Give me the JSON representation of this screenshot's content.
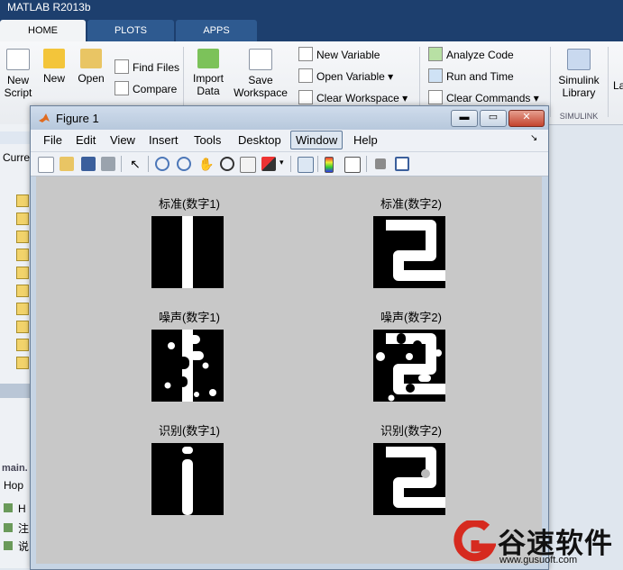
{
  "app_title": "MATLAB R2013b",
  "tabs": [
    "HOME",
    "PLOTS",
    "APPS"
  ],
  "ribbon": {
    "new_script": "New\nScript",
    "new": "New",
    "open": "Open",
    "find_files": "Find Files",
    "compare": "Compare",
    "import_data": "Import\nData",
    "save_workspace": "Save\nWorkspace",
    "new_variable": "New Variable",
    "open_variable": "Open Variable",
    "clear_workspace": "Clear Workspace",
    "analyze_code": "Analyze Code",
    "run_and_time": "Run and Time",
    "clear_commands": "Clear Commands",
    "simulink_library": "Simulink\nLibrary",
    "simulink_group": "SIMULINK",
    "layout_partial": "La"
  },
  "left_panel": {
    "current_folder_partial": "Curre",
    "file_partial": "main.",
    "ws_partial": "Hop",
    "items_partial": [
      "H",
      "注",
      "说"
    ]
  },
  "figure": {
    "title": "Figure 1",
    "menu": [
      "File",
      "Edit",
      "View",
      "Insert",
      "Tools",
      "Desktop",
      "Window",
      "Help"
    ],
    "menu_selected": "Window",
    "panels": [
      {
        "title": "标准(数字1)",
        "digit": 1,
        "kind": "standard"
      },
      {
        "title": "标准(数字2)",
        "digit": 2,
        "kind": "standard"
      },
      {
        "title": "噪声(数字1)",
        "digit": 1,
        "kind": "noise"
      },
      {
        "title": "噪声(数字2)",
        "digit": 2,
        "kind": "noise"
      },
      {
        "title": "识别(数字1)",
        "digit": 1,
        "kind": "recognized"
      },
      {
        "title": "识别(数字2)",
        "digit": 2,
        "kind": "recognized"
      }
    ]
  },
  "watermark": {
    "brand": "谷速软件",
    "url": "www.gusuoft.com"
  },
  "colors": {
    "title_bar": "#1d3f6e",
    "watermark_red": "#d62a1f"
  }
}
